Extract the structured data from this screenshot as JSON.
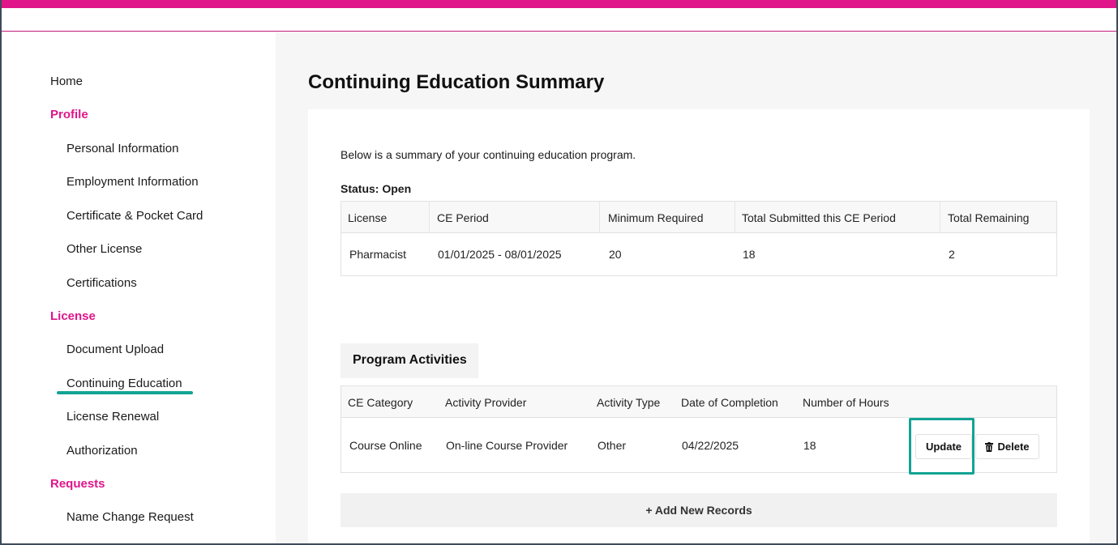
{
  "sidebar": {
    "home": "Home",
    "sections": [
      {
        "title": "Profile",
        "items": [
          "Personal Information",
          "Employment Information",
          "Certificate & Pocket Card",
          "Other License",
          "Certifications"
        ]
      },
      {
        "title": "License",
        "items": [
          "Document Upload",
          "Continuing Education",
          "License Renewal",
          "Authorization"
        ]
      },
      {
        "title": "Requests",
        "items": [
          "Name Change Request"
        ]
      }
    ],
    "active_item": "Continuing Education"
  },
  "main": {
    "title": "Continuing Education Summary",
    "intro": "Below is a summary of your continuing education program.",
    "status_label": "Status:",
    "status_value": "Open",
    "summary_table": {
      "headers": [
        "License",
        "CE Period",
        "Minimum Required",
        "Total Submitted this CE Period",
        "Total Remaining"
      ],
      "row": [
        "Pharmacist",
        "01/01/2025 - 08/01/2025",
        "20",
        "18",
        "2"
      ]
    },
    "activities_tab": "Program Activities",
    "activities_table": {
      "headers": [
        "CE Category",
        "Activity Provider",
        "Activity Type",
        "Date of Completion",
        "Number of Hours"
      ],
      "row": [
        "Course Online",
        "On-line Course Provider",
        "Other",
        "04/22/2025",
        "18"
      ]
    },
    "update_label": "Update",
    "delete_label": "Delete",
    "add_records_label": "+ Add New Records"
  },
  "colors": {
    "brand": "#e0158a",
    "highlight": "#13a394"
  }
}
